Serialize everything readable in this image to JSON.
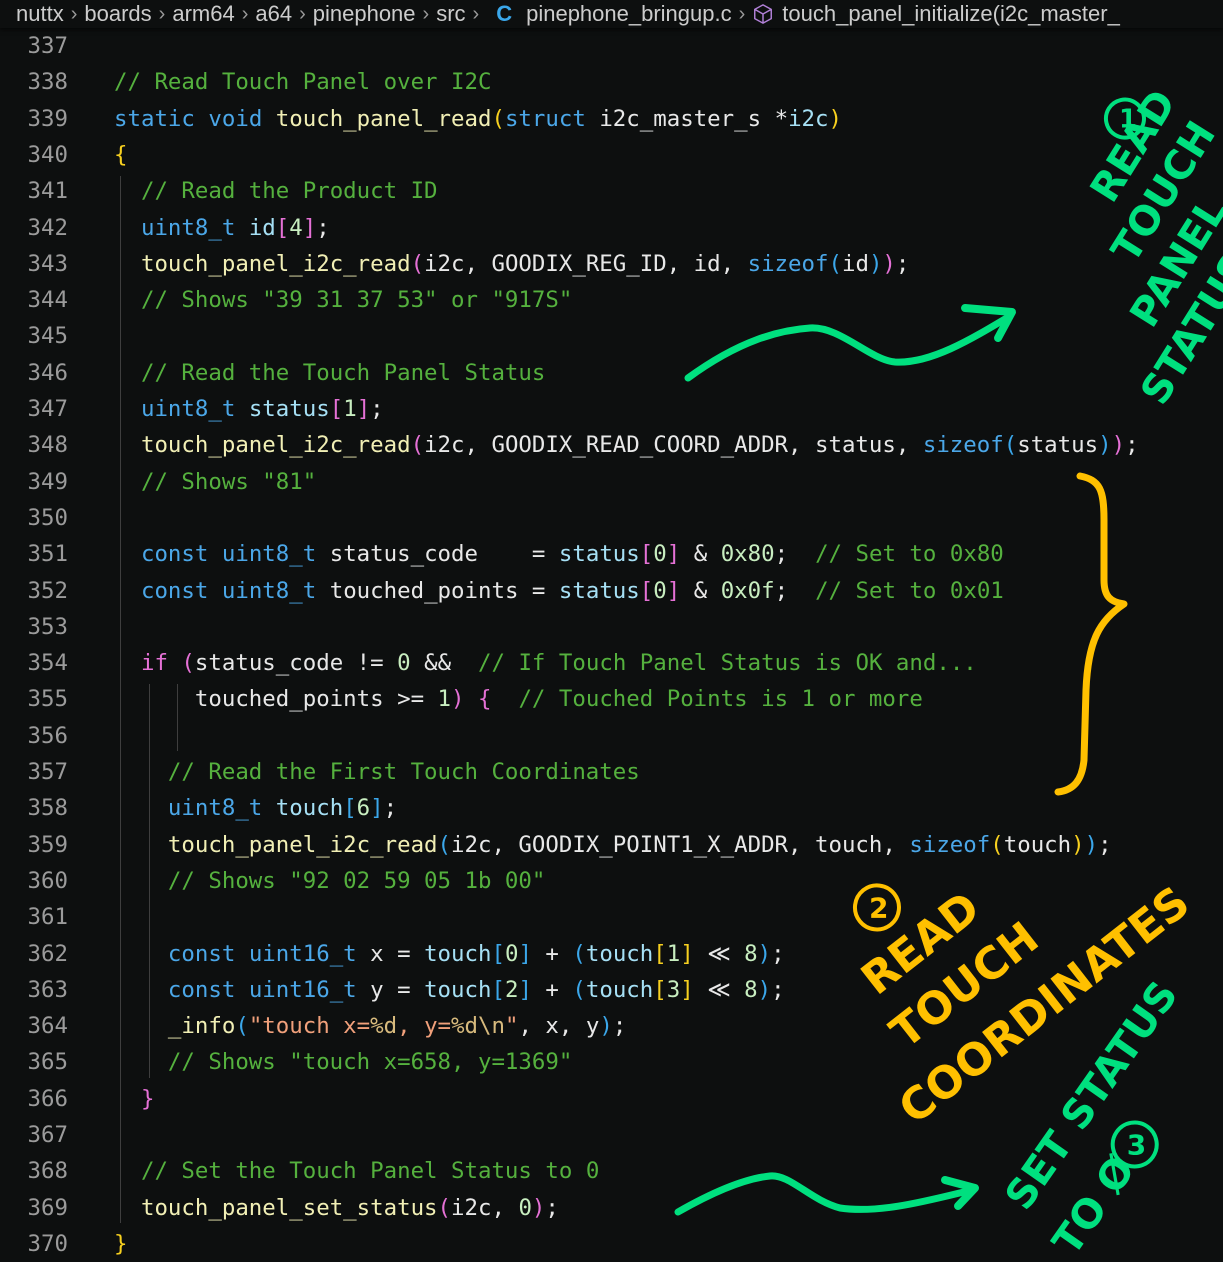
{
  "breadcrumb": {
    "items": [
      "nuttx",
      "boards",
      "arm64",
      "a64",
      "pinephone",
      "src"
    ],
    "file_icon": "C",
    "file": "pinephone_bringup.c",
    "symbol": "touch_panel_initialize(i2c_master_"
  },
  "colors": {
    "background": "#0d0f0f",
    "comment": "#55b13e",
    "keyword": "#4ba7e8",
    "function": "#f1efb5",
    "annotation_green": "#00e07f",
    "annotation_yellow": "#ffc000"
  },
  "lines": [
    {
      "n": "337",
      "tokens": []
    },
    {
      "n": "338",
      "tokens": [
        [
          "cm",
          "// Read Touch Panel over I2C"
        ]
      ]
    },
    {
      "n": "339",
      "tokens": [
        [
          "kw",
          "static"
        ],
        [
          "pl",
          " "
        ],
        [
          "kw",
          "void"
        ],
        [
          "pl",
          " "
        ],
        [
          "fn",
          "touch_panel_read"
        ],
        [
          "b1",
          "("
        ],
        [
          "kw",
          "struct"
        ],
        [
          "pl",
          " i2c_master_s *"
        ],
        [
          "var",
          "i2c"
        ],
        [
          "b1",
          ")"
        ]
      ]
    },
    {
      "n": "340",
      "tokens": [
        [
          "b1",
          "{"
        ]
      ]
    },
    {
      "n": "341",
      "tokens": [
        [
          "pl",
          "  "
        ],
        [
          "cm",
          "// Read the Product ID"
        ]
      ]
    },
    {
      "n": "342",
      "tokens": [
        [
          "pl",
          "  "
        ],
        [
          "ty",
          "uint8_t"
        ],
        [
          "pl",
          " "
        ],
        [
          "var",
          "id"
        ],
        [
          "b2",
          "["
        ],
        [
          "num",
          "4"
        ],
        [
          "b2",
          "]"
        ],
        [
          "pl",
          ";"
        ]
      ]
    },
    {
      "n": "343",
      "tokens": [
        [
          "pl",
          "  "
        ],
        [
          "fn",
          "touch_panel_i2c_read"
        ],
        [
          "b2",
          "("
        ],
        [
          "pl",
          "i2c, GOODIX_REG_ID, id, "
        ],
        [
          "kw",
          "sizeof"
        ],
        [
          "b3",
          "("
        ],
        [
          "pl",
          "id"
        ],
        [
          "b3",
          ")"
        ],
        [
          "b2",
          ")"
        ],
        [
          "pl",
          ";"
        ]
      ]
    },
    {
      "n": "344",
      "tokens": [
        [
          "pl",
          "  "
        ],
        [
          "cm",
          "// Shows \"39 31 37 53\" or \"917S\""
        ]
      ]
    },
    {
      "n": "345",
      "tokens": []
    },
    {
      "n": "346",
      "tokens": [
        [
          "pl",
          "  "
        ],
        [
          "cm",
          "// Read the Touch Panel Status"
        ]
      ]
    },
    {
      "n": "347",
      "tokens": [
        [
          "pl",
          "  "
        ],
        [
          "ty",
          "uint8_t"
        ],
        [
          "pl",
          " "
        ],
        [
          "var",
          "status"
        ],
        [
          "b2",
          "["
        ],
        [
          "num",
          "1"
        ],
        [
          "b2",
          "]"
        ],
        [
          "pl",
          ";"
        ]
      ]
    },
    {
      "n": "348",
      "tokens": [
        [
          "pl",
          "  "
        ],
        [
          "fn",
          "touch_panel_i2c_read"
        ],
        [
          "b2",
          "("
        ],
        [
          "pl",
          "i2c, GOODIX_READ_COORD_ADDR, status, "
        ],
        [
          "kw",
          "sizeof"
        ],
        [
          "b3",
          "("
        ],
        [
          "pl",
          "status"
        ],
        [
          "b3",
          ")"
        ],
        [
          "b2",
          ")"
        ],
        [
          "pl",
          ";"
        ]
      ]
    },
    {
      "n": "349",
      "tokens": [
        [
          "pl",
          "  "
        ],
        [
          "cm",
          "// Shows \"81\""
        ]
      ]
    },
    {
      "n": "350",
      "tokens": []
    },
    {
      "n": "351",
      "tokens": [
        [
          "pl",
          "  "
        ],
        [
          "kw",
          "const"
        ],
        [
          "pl",
          " "
        ],
        [
          "ty",
          "uint8_t"
        ],
        [
          "pl",
          " status_code    = "
        ],
        [
          "var",
          "status"
        ],
        [
          "b2",
          "["
        ],
        [
          "num",
          "0"
        ],
        [
          "b2",
          "]"
        ],
        [
          "pl",
          " & "
        ],
        [
          "num",
          "0x80"
        ],
        [
          "pl",
          ";  "
        ],
        [
          "cm",
          "// Set to 0x80"
        ]
      ]
    },
    {
      "n": "352",
      "tokens": [
        [
          "pl",
          "  "
        ],
        [
          "kw",
          "const"
        ],
        [
          "pl",
          " "
        ],
        [
          "ty",
          "uint8_t"
        ],
        [
          "pl",
          " touched_points = "
        ],
        [
          "var",
          "status"
        ],
        [
          "b2",
          "["
        ],
        [
          "num",
          "0"
        ],
        [
          "b2",
          "]"
        ],
        [
          "pl",
          " & "
        ],
        [
          "num",
          "0x0f"
        ],
        [
          "pl",
          ";  "
        ],
        [
          "cm",
          "// Set to 0x01"
        ]
      ]
    },
    {
      "n": "353",
      "tokens": []
    },
    {
      "n": "354",
      "tokens": [
        [
          "pl",
          "  "
        ],
        [
          "ctl",
          "if"
        ],
        [
          "pl",
          " "
        ],
        [
          "b2",
          "("
        ],
        [
          "pl",
          "status_code != "
        ],
        [
          "num",
          "0"
        ],
        [
          "pl",
          " &&  "
        ],
        [
          "cm",
          "// If Touch Panel Status is OK and..."
        ]
      ]
    },
    {
      "n": "355",
      "tokens": [
        [
          "pl",
          "      touched_points >= "
        ],
        [
          "num",
          "1"
        ],
        [
          "b2",
          ")"
        ],
        [
          "pl",
          " "
        ],
        [
          "b2",
          "{"
        ],
        [
          "pl",
          "  "
        ],
        [
          "cm",
          "// Touched Points is 1 or more"
        ]
      ]
    },
    {
      "n": "356",
      "tokens": []
    },
    {
      "n": "357",
      "tokens": [
        [
          "pl",
          "    "
        ],
        [
          "cm",
          "// Read the First Touch Coordinates"
        ]
      ]
    },
    {
      "n": "358",
      "tokens": [
        [
          "pl",
          "    "
        ],
        [
          "ty",
          "uint8_t"
        ],
        [
          "pl",
          " "
        ],
        [
          "var",
          "touch"
        ],
        [
          "b3",
          "["
        ],
        [
          "num",
          "6"
        ],
        [
          "b3",
          "]"
        ],
        [
          "pl",
          ";"
        ]
      ]
    },
    {
      "n": "359",
      "tokens": [
        [
          "pl",
          "    "
        ],
        [
          "fn",
          "touch_panel_i2c_read"
        ],
        [
          "b3",
          "("
        ],
        [
          "pl",
          "i2c, GOODIX_POINT1_X_ADDR, touch, "
        ],
        [
          "kw",
          "sizeof"
        ],
        [
          "b1",
          "("
        ],
        [
          "pl",
          "touch"
        ],
        [
          "b1",
          ")"
        ],
        [
          "b3",
          ")"
        ],
        [
          "pl",
          ";"
        ]
      ]
    },
    {
      "n": "360",
      "tokens": [
        [
          "pl",
          "    "
        ],
        [
          "cm",
          "// Shows \"92 02 59 05 1b 00\""
        ]
      ]
    },
    {
      "n": "361",
      "tokens": []
    },
    {
      "n": "362",
      "tokens": [
        [
          "pl",
          "    "
        ],
        [
          "kw",
          "const"
        ],
        [
          "pl",
          " "
        ],
        [
          "ty",
          "uint16_t"
        ],
        [
          "pl",
          " x = "
        ],
        [
          "var",
          "touch"
        ],
        [
          "b3",
          "["
        ],
        [
          "num",
          "0"
        ],
        [
          "b3",
          "]"
        ],
        [
          "pl",
          " + "
        ],
        [
          "b3",
          "("
        ],
        [
          "var",
          "touch"
        ],
        [
          "b1",
          "["
        ],
        [
          "num",
          "1"
        ],
        [
          "b1",
          "]"
        ],
        [
          "pl",
          " ≪ "
        ],
        [
          "num",
          "8"
        ],
        [
          "b3",
          ")"
        ],
        [
          "pl",
          ";"
        ]
      ]
    },
    {
      "n": "363",
      "tokens": [
        [
          "pl",
          "    "
        ],
        [
          "kw",
          "const"
        ],
        [
          "pl",
          " "
        ],
        [
          "ty",
          "uint16_t"
        ],
        [
          "pl",
          " y = "
        ],
        [
          "var",
          "touch"
        ],
        [
          "b3",
          "["
        ],
        [
          "num",
          "2"
        ],
        [
          "b3",
          "]"
        ],
        [
          "pl",
          " + "
        ],
        [
          "b3",
          "("
        ],
        [
          "var",
          "touch"
        ],
        [
          "b1",
          "["
        ],
        [
          "num",
          "3"
        ],
        [
          "b1",
          "]"
        ],
        [
          "pl",
          " ≪ "
        ],
        [
          "num",
          "8"
        ],
        [
          "b3",
          ")"
        ],
        [
          "pl",
          ";"
        ]
      ]
    },
    {
      "n": "364",
      "tokens": [
        [
          "pl",
          "    "
        ],
        [
          "fn",
          "_info"
        ],
        [
          "b3",
          "("
        ],
        [
          "str",
          "\"touch x="
        ],
        [
          "esc",
          "%d"
        ],
        [
          "str",
          ", y="
        ],
        [
          "esc",
          "%d"
        ],
        [
          "esc",
          "\\n"
        ],
        [
          "str",
          "\""
        ],
        [
          "pl",
          ", x, y"
        ],
        [
          "b3",
          ")"
        ],
        [
          "pl",
          ";"
        ]
      ]
    },
    {
      "n": "365",
      "tokens": [
        [
          "pl",
          "    "
        ],
        [
          "cm",
          "// Shows \"touch x=658, y=1369\""
        ]
      ]
    },
    {
      "n": "366",
      "tokens": [
        [
          "pl",
          "  "
        ],
        [
          "b2",
          "}"
        ]
      ]
    },
    {
      "n": "367",
      "tokens": []
    },
    {
      "n": "368",
      "tokens": [
        [
          "pl",
          "  "
        ],
        [
          "cm",
          "// Set the Touch Panel Status to 0"
        ]
      ]
    },
    {
      "n": "369",
      "tokens": [
        [
          "pl",
          "  "
        ],
        [
          "fn",
          "touch_panel_set_status"
        ],
        [
          "b2",
          "("
        ],
        [
          "pl",
          "i2c, "
        ],
        [
          "num",
          "0"
        ],
        [
          "b2",
          ")"
        ],
        [
          "pl",
          ";"
        ]
      ]
    },
    {
      "n": "370",
      "tokens": [
        [
          "b1",
          "}"
        ]
      ]
    }
  ],
  "annotations": {
    "step1": {
      "number": "1",
      "lines": [
        "READ",
        "TOUCH",
        "PANEL",
        "STATUS"
      ]
    },
    "step2": {
      "number": "2",
      "lines": [
        "READ",
        "TOUCH",
        "COORDINATES"
      ]
    },
    "step3": {
      "number": "3",
      "lines": [
        "SET STATUS",
        "TO Ø"
      ]
    }
  }
}
